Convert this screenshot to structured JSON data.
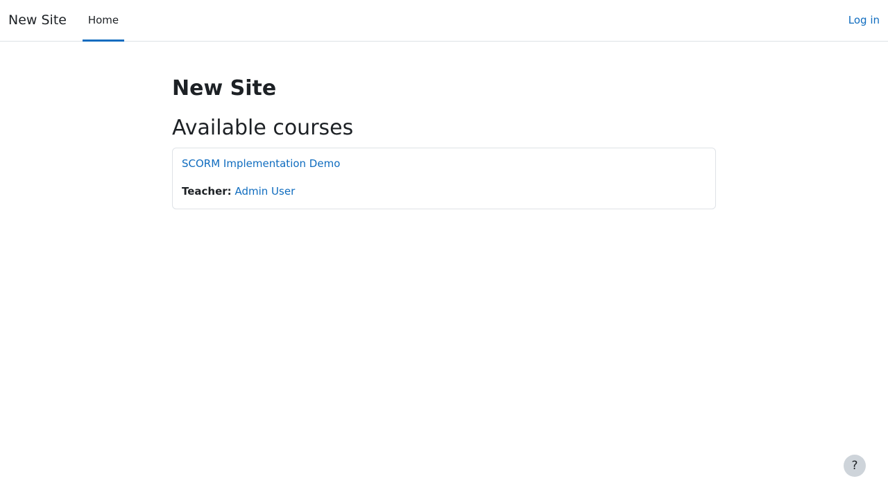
{
  "navbar": {
    "brand": "New Site",
    "home_label": "Home",
    "login_label": "Log in"
  },
  "main": {
    "page_title": "New Site",
    "section_title": "Available courses",
    "courses": [
      {
        "name": "SCORM Implementation Demo",
        "teacher_label": "Teacher:",
        "teacher_name": "Admin User"
      }
    ]
  },
  "footer": {
    "help_label": "?"
  },
  "colors": {
    "accent": "#0f6cbf",
    "text": "#1d2125",
    "border": "#dee2e6",
    "help_bg": "#ced4da"
  }
}
